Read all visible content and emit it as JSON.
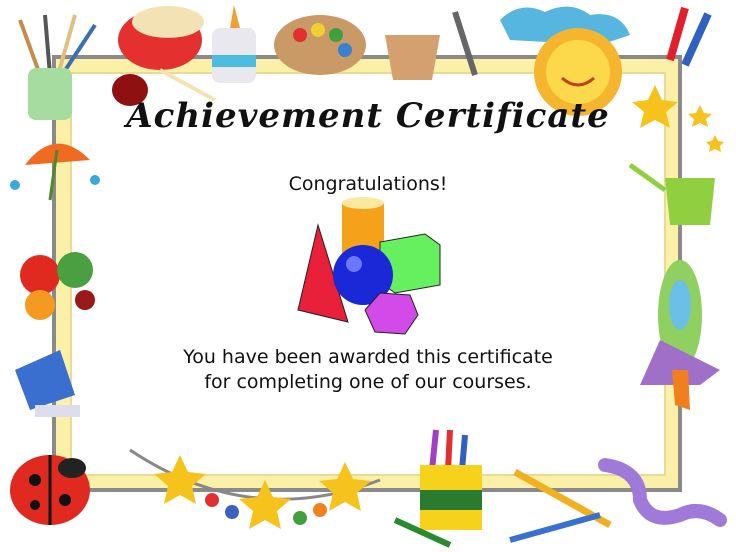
{
  "certificate": {
    "title": "Achievement Certificate",
    "greeting": "Congratulations!",
    "message_line1": "You have been awarded this certificate",
    "message_line2": "for completing one of our courses."
  },
  "colors": {
    "frame_gray": "#8a8a8a",
    "frame_yellow": "#fbf0a8"
  },
  "icons": [
    "paintbrush-cup-icon",
    "drum-icon",
    "glue-bottle-icon",
    "paint-palette-icon",
    "flower-pot-icon",
    "cloud-icon",
    "sun-icon",
    "crayons-icon",
    "star-icon",
    "umbrella-icon",
    "fruit-icon",
    "watering-can-icon",
    "rocket-icon",
    "paint-bucket-icon",
    "ladybug-icon",
    "star-garland-icon",
    "crayon-box-icon",
    "pencil-icon",
    "worm-icon",
    "geometric-shapes-icon"
  ]
}
